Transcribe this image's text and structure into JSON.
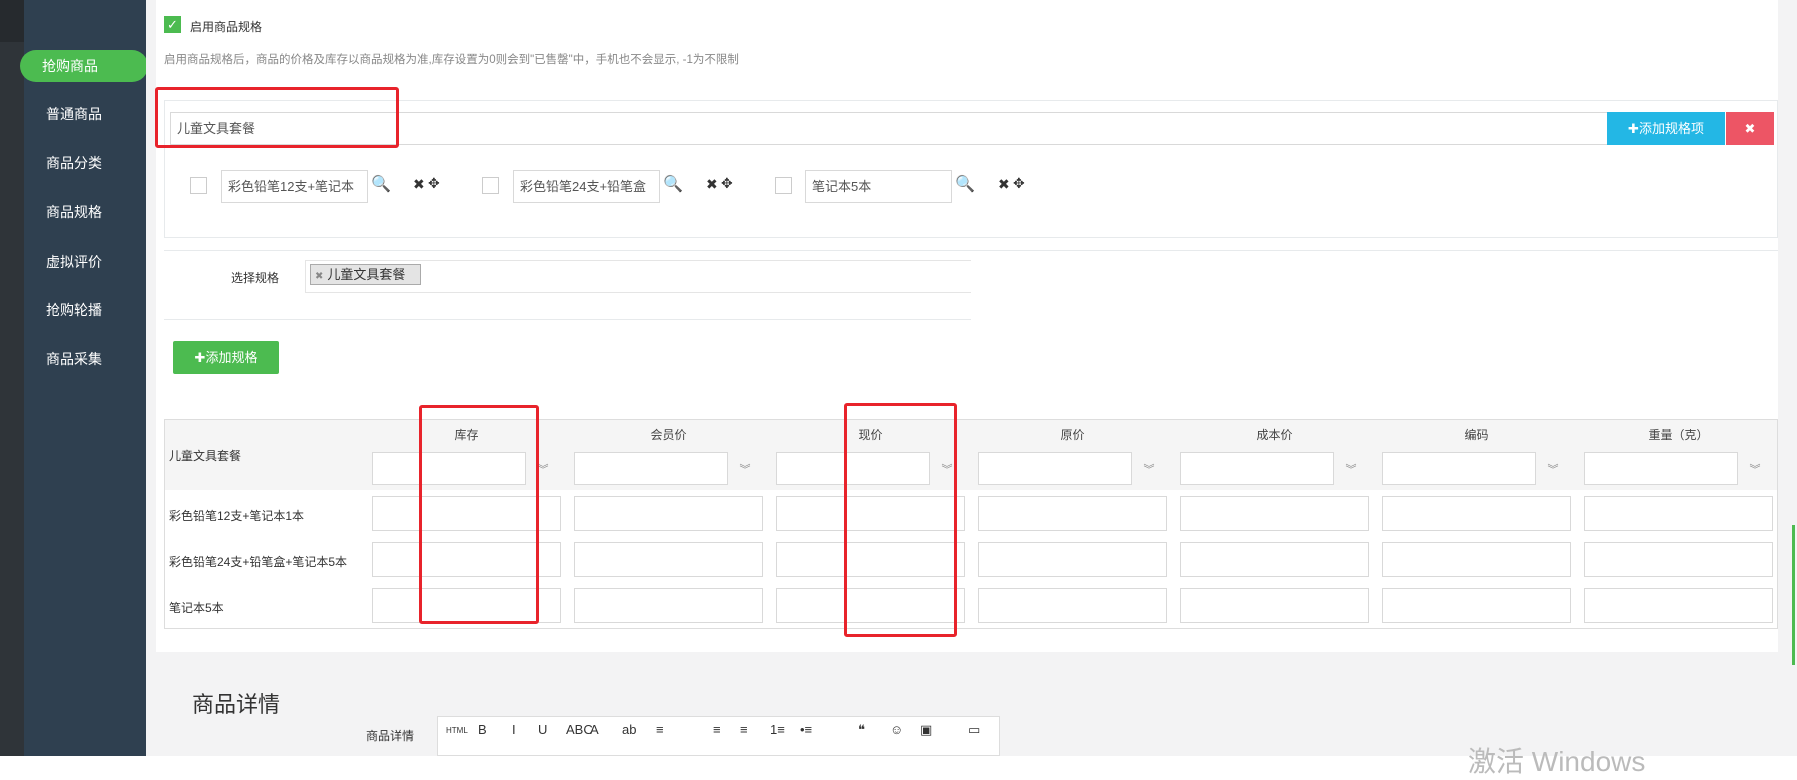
{
  "sidebar": {
    "items": [
      {
        "label": "抢购商品",
        "active": true
      },
      {
        "label": "普通商品"
      },
      {
        "label": "商品分类"
      },
      {
        "label": "商品规格"
      },
      {
        "label": "虚拟评价"
      },
      {
        "label": "抢购轮播"
      },
      {
        "label": "商品采集"
      }
    ]
  },
  "spec_toggle": {
    "label": "启用商品规格",
    "checked": true,
    "hint": "启用商品规格后，商品的价格及库存以商品规格为准,库存设置为0则会到\"已售罄\"中，手机也不会显示, -1为不限制"
  },
  "spec_group": {
    "name_value": "儿童文具套餐",
    "add_item_label": "添加规格项",
    "items": [
      {
        "value": "彩色铅笔12支+笔记本"
      },
      {
        "value": "彩色铅笔24支+铅笔盒"
      },
      {
        "value": "笔记本5本"
      }
    ]
  },
  "select_spec": {
    "label": "选择规格",
    "tag": "儿童文具套餐"
  },
  "add_spec_label": "添加规格",
  "table": {
    "group_label": "儿童文具套餐",
    "columns": [
      "库存",
      "会员价",
      "现价",
      "原价",
      "成本价",
      "编码",
      "重量（克）"
    ],
    "rows": [
      "彩色铅笔12支+笔记本1本",
      "彩色铅笔24支+铅笔盒+笔记本5本",
      "笔记本5本"
    ]
  },
  "details": {
    "section_title": "商品详情",
    "field_label": "商品详情",
    "toolbar": [
      "HTML",
      "B",
      "I",
      "U",
      "ABC",
      "A",
      "ab",
      "≡",
      "≡",
      "≡",
      "1≡",
      "•≡",
      "❝",
      "☺",
      "▣",
      "▭"
    ]
  },
  "watermark": "激活 Windows",
  "colors": {
    "accent_green": "#4cbb50",
    "sidebar_bg": "#2f4050",
    "add_item_blue": "#23b7e5",
    "delete_red": "#ed5565",
    "highlight_red": "#e8232b"
  }
}
